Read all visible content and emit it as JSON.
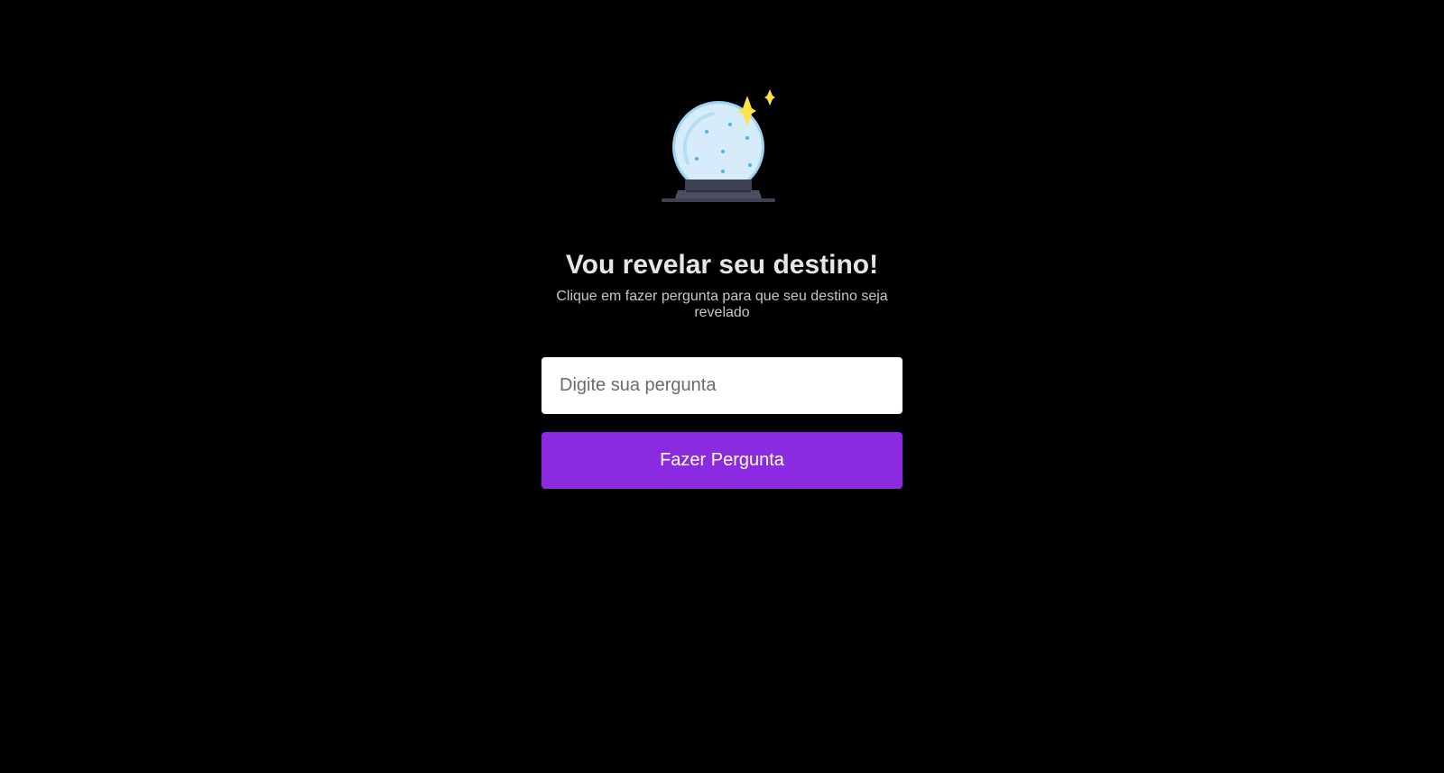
{
  "illustration": {
    "icon": "crystal-ball-icon",
    "colors": {
      "globe": "#d6ecfb",
      "globe_outline": "#9fd3f5",
      "dots": "#4fb3e8",
      "sparkle": "#ffe24a",
      "base": "#3d4152",
      "base_dark": "#2b2f3d"
    }
  },
  "heading": {
    "title": "Vou revelar seu destino!",
    "subtitle": "Clique em fazer pergunta para que seu destino seja revelado"
  },
  "form": {
    "question_input": {
      "value": "",
      "placeholder": "Digite sua pergunta"
    },
    "ask_button_label": "Fazer Pergunta"
  },
  "theme": {
    "background": "#000000",
    "accent": "#8a2be2",
    "title_color": "#e6e6e6",
    "subtitle_color": "#c7c7c7"
  }
}
